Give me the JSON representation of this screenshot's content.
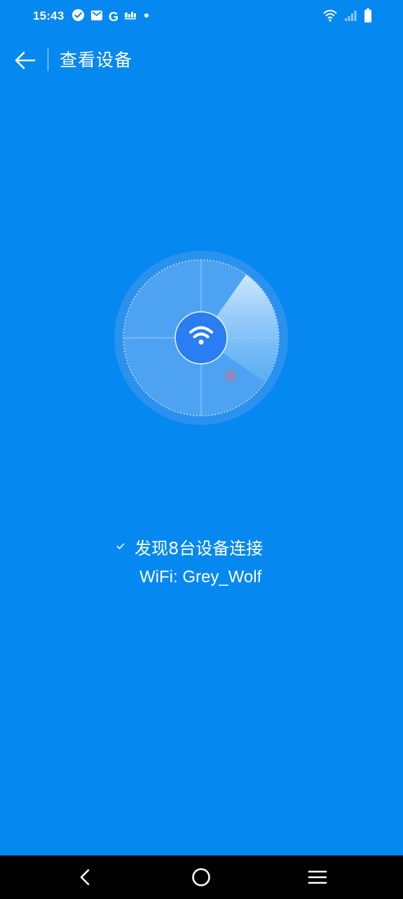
{
  "status_bar": {
    "time": "15:43",
    "left_icons": [
      "check-circle-icon",
      "mail-icon",
      "google-icon",
      "notification-app-icon",
      "dot-icon"
    ],
    "right_icons": [
      "wifi-icon",
      "cellular-signal-icon",
      "battery-icon"
    ],
    "google_letter": "G"
  },
  "app_bar": {
    "title": "查看设备"
  },
  "radar": {
    "center_icon": "wifi-icon",
    "colors": {
      "outer_ring": "#2b91ee",
      "disk": "#4da3f2",
      "center": "#2a7df2",
      "device_dot": "#e4627a"
    }
  },
  "result": {
    "found_text": "发现8台设备连接",
    "wifi_label": "WiFi: Grey_Wolf"
  },
  "nav_bar": {
    "buttons": [
      "back-nav",
      "home-nav",
      "recents-nav"
    ]
  }
}
